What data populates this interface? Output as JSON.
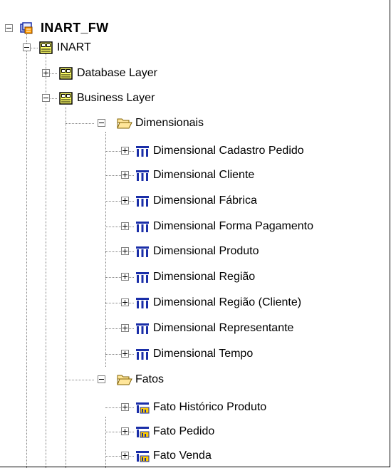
{
  "tree": {
    "root": {
      "label": "INART_FW",
      "expanded": true,
      "icon": "package-icon"
    },
    "model": {
      "label": "INART",
      "expanded": true,
      "icon": "namespace-icon"
    },
    "database_layer": {
      "label": "Database Layer",
      "expanded": false,
      "icon": "namespace-icon"
    },
    "business_layer": {
      "label": "Business Layer",
      "expanded": true,
      "icon": "namespace-icon"
    },
    "dimensionais": {
      "label": "Dimensionais",
      "expanded": true,
      "icon": "folder-open-icon",
      "items": [
        {
          "label": "Dimensional Cadastro Pedido",
          "icon": "dimension-icon"
        },
        {
          "label": "Dimensional Cliente",
          "icon": "dimension-icon"
        },
        {
          "label": "Dimensional Fábrica",
          "icon": "dimension-icon"
        },
        {
          "label": "Dimensional Forma Pagamento",
          "icon": "dimension-icon"
        },
        {
          "label": "Dimensional Produto",
          "icon": "dimension-icon"
        },
        {
          "label": "Dimensional Região",
          "icon": "dimension-icon"
        },
        {
          "label": "Dimensional Região (Cliente)",
          "icon": "dimension-icon"
        },
        {
          "label": "Dimensional Representante",
          "icon": "dimension-icon"
        },
        {
          "label": "Dimensional Tempo",
          "icon": "dimension-icon"
        }
      ]
    },
    "fatos": {
      "label": "Fatos",
      "expanded": true,
      "icon": "folder-open-icon",
      "items": [
        {
          "label": "Fato Histórico Produto",
          "icon": "fact-icon"
        },
        {
          "label": "Fato Pedido",
          "icon": "fact-icon"
        },
        {
          "label": "Fato Venda",
          "icon": "fact-icon"
        }
      ]
    }
  },
  "colors": {
    "namespace_icon_fill": "#ffff66",
    "folder_fill": "#ffe69a",
    "dimension_blue": "#1a2ea8",
    "fact_yellow": "#ffcc00"
  }
}
